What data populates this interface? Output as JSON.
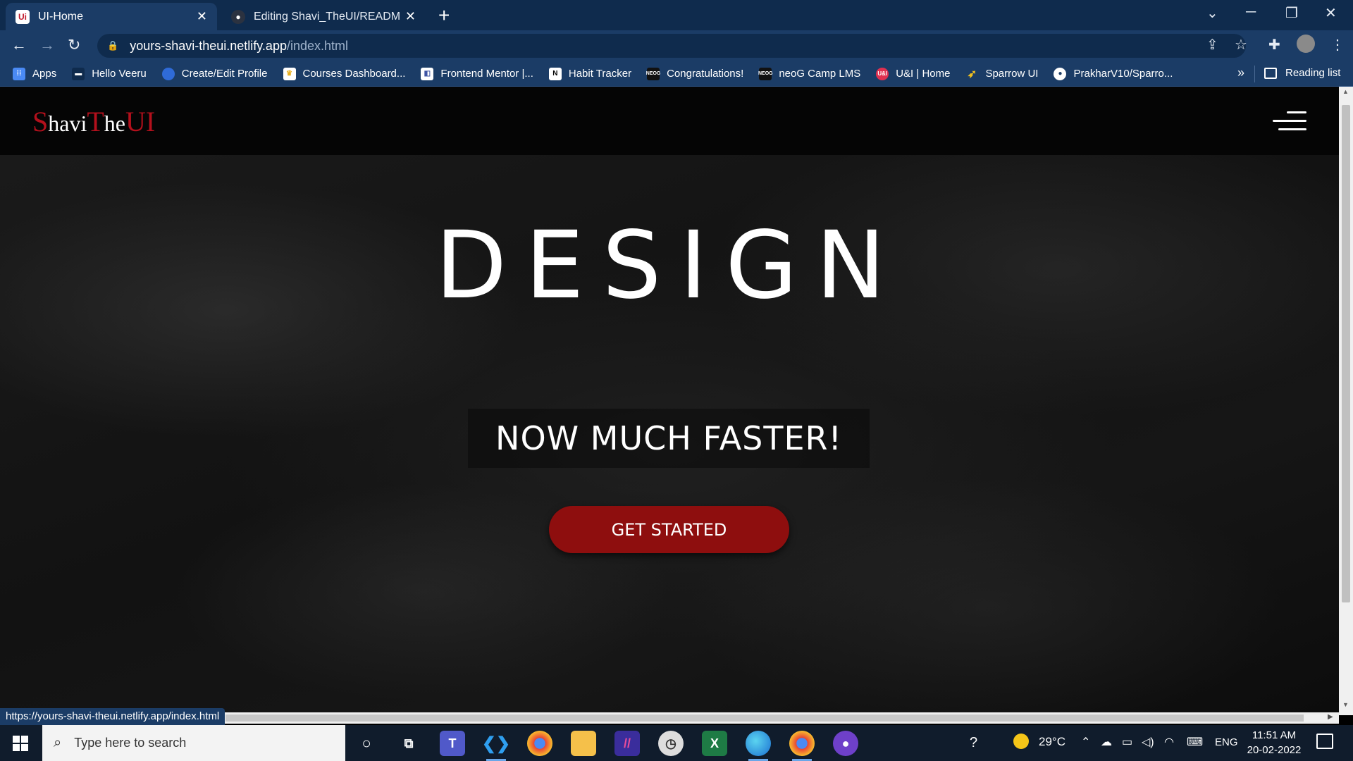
{
  "browser": {
    "tabs": [
      {
        "label": "UI-Home",
        "icon": "ui-logo-icon",
        "active": true
      },
      {
        "label": "Editing Shavi_TheUI/README.md",
        "icon": "github-icon",
        "active": false
      }
    ],
    "url_host": "yours-shavi-theui.netlify.app",
    "url_path": "/index.html",
    "bookmarks": [
      {
        "label": "Apps",
        "icon": "apps-grid-icon",
        "color": "#4a8af4"
      },
      {
        "label": "Hello Veeru",
        "icon": "hello-veeru-icon",
        "color": "#1b3c66"
      },
      {
        "label": "Create/Edit Profile",
        "icon": "globe-icon",
        "color": "#2f6bd8"
      },
      {
        "label": "Courses Dashboard...",
        "icon": "courses-icon",
        "color": "#f5c84b"
      },
      {
        "label": "Frontend Mentor |...",
        "icon": "frontend-mentor-icon",
        "color": "#ffffff"
      },
      {
        "label": "Habit Tracker",
        "icon": "notion-icon",
        "color": "#ffffff"
      },
      {
        "label": "Congratulations!",
        "icon": "neog-icon",
        "color": "#111111"
      },
      {
        "label": "neoG Camp LMS",
        "icon": "neog-icon",
        "color": "#111111"
      },
      {
        "label": "U&I | Home",
        "icon": "ui-logo-icon",
        "color": "#e03050"
      },
      {
        "label": "Sparrow UI",
        "icon": "sparrow-icon",
        "color": "#f0c020"
      },
      {
        "label": "PrakharV10/Sparro...",
        "icon": "github-icon",
        "color": "#ffffff"
      }
    ],
    "reading_list": "Reading list",
    "status_url": "https://yours-shavi-theui.netlify.app/index.html"
  },
  "site": {
    "logo": {
      "s": "S",
      "havi": "havi",
      "t": "T",
      "he": "he",
      "ui": "UI"
    },
    "hero_title": "DESIGN",
    "tagline": "NOW MUCH FASTER!",
    "cta_label": "GET STARTED",
    "accent_color": "#8e0e0e"
  },
  "taskbar": {
    "search_placeholder": "Type here to search",
    "weather": "29°C",
    "language": "ENG",
    "time": "11:51 AM",
    "date": "20-02-2022"
  }
}
